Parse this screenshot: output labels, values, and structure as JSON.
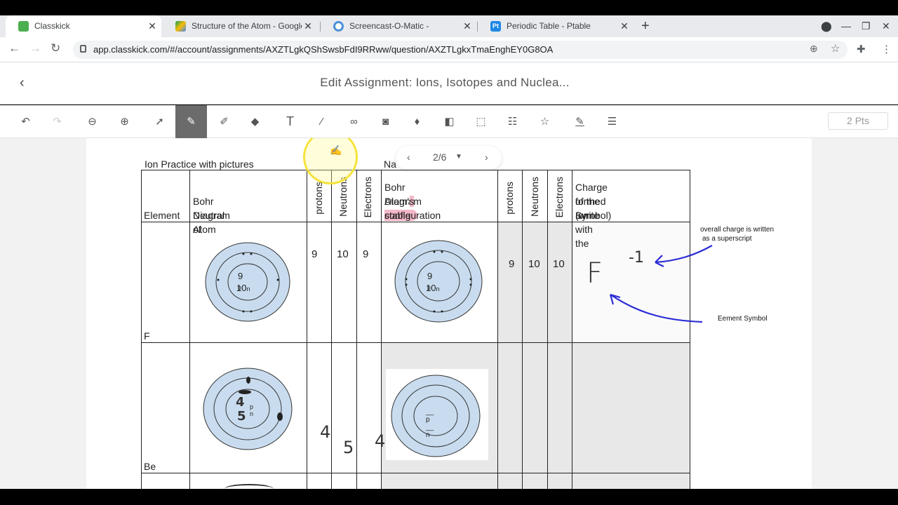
{
  "tabs": [
    {
      "label": "Classkick",
      "fav": "#4caf50",
      "active": true
    },
    {
      "label": "Structure of the Atom - Google D",
      "fav": "#fbbc04",
      "active": false
    },
    {
      "label": "Screencast-O-Matic -",
      "fav": "#4a90d9",
      "active": false
    },
    {
      "label": "Periodic Table - Ptable",
      "fav": "#1e88e5",
      "favtext": "Pt",
      "active": false
    }
  ],
  "address": {
    "url": "app.classkick.com/#/account/assignments/AXZTLgkQShSwsbFdI9RRww/question/AXZTLgkxTmaEnghEY0G8OA"
  },
  "app": {
    "title": "Edit Assignment: Ions, Isotopes and Nuclea...",
    "points": "2 Pts"
  },
  "pager": {
    "label": "2/6"
  },
  "worksheet": {
    "caption": "Ion Practice with pictures",
    "caption2": "Na",
    "headers": {
      "element": "Element",
      "bohr_neutral": [
        "Bohr Diagram of",
        "Neutral Atom"
      ],
      "protons": "protons",
      "neutrons": "Neutrons",
      "electrons": "Electrons",
      "bohr_stable": [
        "Bohr Diagram of the",
        "Atom's stable",
        "configuration"
      ],
      "protons2": "protons",
      "neutrons2": "Neutrons",
      "electrons2": "Electrons",
      "charge": [
        "Charge of the Ion",
        "formed (write with the",
        "Symbol)"
      ]
    },
    "rows": [
      {
        "element": "F",
        "protons": "9",
        "neutrons": "10",
        "electrons": "9",
        "atom_p": "9",
        "atom_n": "10",
        "protons2": "9",
        "neutrons2": "10",
        "electrons2": "10",
        "hw_symbol": "F",
        "hw_charge": "-1"
      },
      {
        "element": "Be",
        "hw_p": "4",
        "hw_n": "5",
        "hw_e": "4",
        "atom_p": "4",
        "atom_n": "5"
      }
    ],
    "notes": {
      "superscript": [
        "overall charge is written",
        "as a superscript"
      ],
      "symbol": "Eement Symbol"
    },
    "unit_p": "p",
    "unit_n": "n"
  }
}
